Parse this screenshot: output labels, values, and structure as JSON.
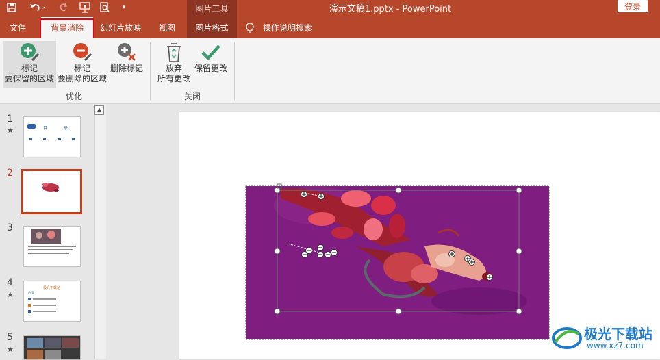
{
  "titlebar": {
    "context_label": "图片工具",
    "document_title": "演示文稿1.pptx  -  PowerPoint",
    "login_label": "登录",
    "qa_icons": [
      "save-icon",
      "undo-icon",
      "redo-icon",
      "present-icon",
      "preview-icon",
      "customize-icon"
    ]
  },
  "tabs": [
    {
      "label": "文件"
    },
    {
      "label": "背景消除"
    },
    {
      "label": "幻灯片放映"
    },
    {
      "label": "视图"
    },
    {
      "label": "图片格式"
    },
    {
      "label": "操作说明搜索"
    }
  ],
  "ribbon": {
    "optimize": {
      "mark_keep_l1": "标记",
      "mark_keep_l2": "要保留的区域",
      "mark_remove_l1": "标记",
      "mark_remove_l2": "要删除的区域",
      "delete_mark": "删除标记",
      "group_label": "优化"
    },
    "close": {
      "discard_l1": "放弃",
      "discard_l2": "所有更改",
      "keep": "保留更改",
      "group_label": "关闭"
    }
  },
  "slides": [
    {
      "number": "1",
      "star": "★"
    },
    {
      "number": "2",
      "star": ""
    },
    {
      "number": "3",
      "star": ""
    },
    {
      "number": "4",
      "star": "★"
    },
    {
      "number": "5",
      "star": "★"
    }
  ],
  "thumb_text": {
    "s1_left": "目",
    "s1_right": "录",
    "s4_title": "极光下载站",
    "s4_sub": "目 录"
  },
  "watermark": {
    "main": "极光下载站",
    "sub": "www.xz7.com"
  },
  "colors": {
    "accent": "#b7472a",
    "context": "#8d3522",
    "highlight": "#e60012",
    "purple": "#7f1d80"
  }
}
